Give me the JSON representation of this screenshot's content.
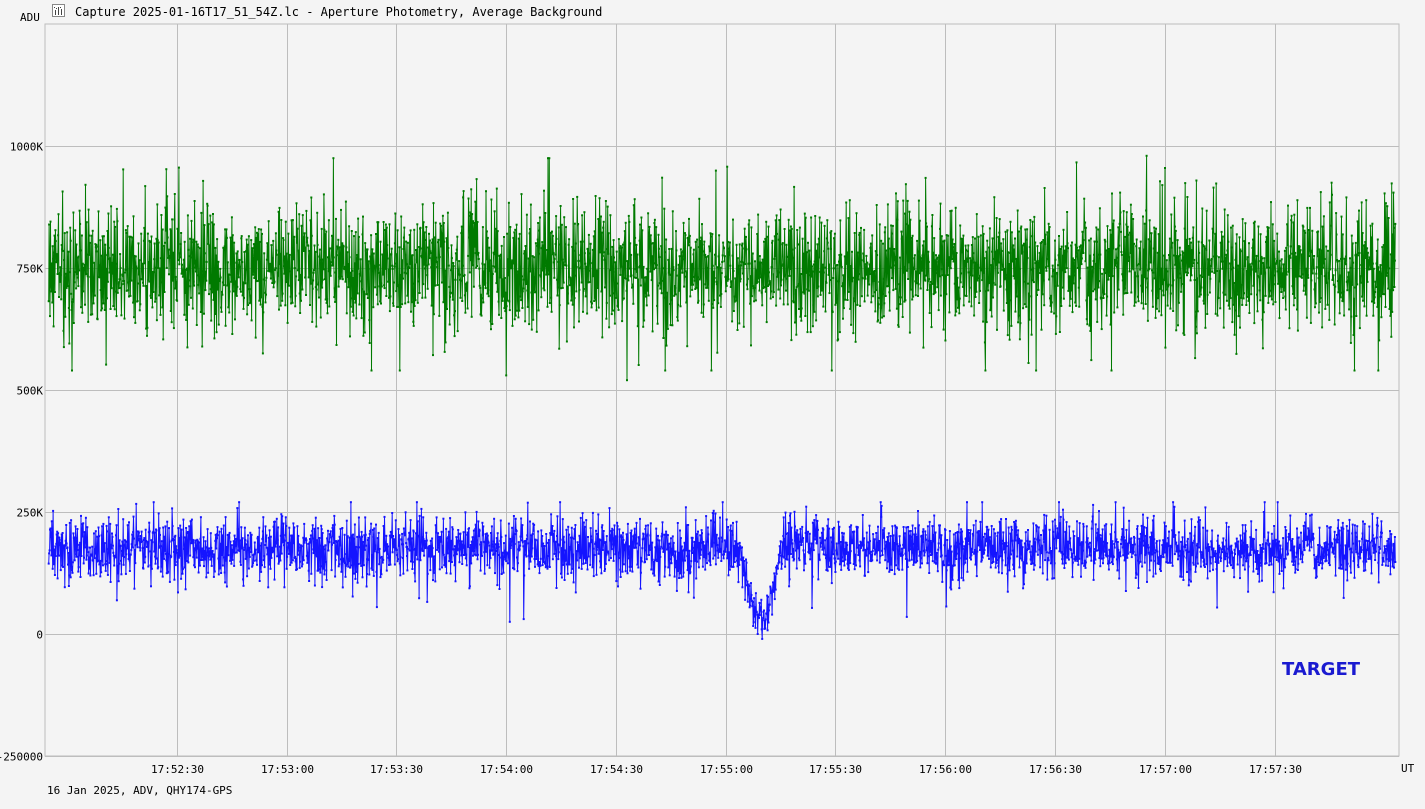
{
  "window": {
    "title": "Capture 2025-01-16T17_51_54Z.lc - Aperture Photometry, Average Background",
    "icon": "lightcurve-icon"
  },
  "footer": "16 Jan 2025, ADV, QHY174-GPS",
  "target_label": "TARGET",
  "colors": {
    "background": "#f4f4f4",
    "grid": "#bdbdbd",
    "series_background": "#007a00",
    "series_target": "#1414ff",
    "target_label": "#1a1ad0"
  },
  "chart_data": {
    "type": "line",
    "title": "",
    "ylabel": "ADU",
    "xlabel": "UT",
    "grid": true,
    "markers": true,
    "xlim": [
      "17:51:54",
      "17:58:04"
    ],
    "ylim": [
      -250000,
      1250000
    ],
    "y_ticks": [
      -250000,
      0,
      250000,
      500000,
      750000,
      1000000
    ],
    "y_tick_labels": [
      "-250000",
      "0",
      "250K",
      "500K",
      "750K",
      "1000K"
    ],
    "x_ticks": [
      "17:52:30",
      "17:53:00",
      "17:53:30",
      "17:54:00",
      "17:54:30",
      "17:55:00",
      "17:55:30",
      "17:56:00",
      "17:56:30",
      "17:57:00",
      "17:57:30"
    ],
    "series": [
      {
        "role": "background",
        "color": "#007a00",
        "summary": {
          "mean": 750000,
          "min": 525000,
          "max": 980000
        },
        "notable_points": [
          {
            "x": "17:54:00",
            "y": 530000
          },
          {
            "x": "17:54:33",
            "y": 520000
          },
          {
            "x": "17:56:55",
            "y": 980000
          },
          {
            "x": "17:57:00",
            "y": 955000
          }
        ]
      },
      {
        "role": "target",
        "color": "#1414ff",
        "summary": {
          "mean": 175000,
          "min": -10000,
          "max": 275000
        },
        "notable_points": [
          {
            "x": "17:54:01",
            "y": 25000
          },
          {
            "x": "17:55:04",
            "y": 180000
          },
          {
            "x": "17:55:05",
            "y": 120000
          },
          {
            "x": "17:55:07",
            "y": 80000
          },
          {
            "x": "17:55:08",
            "y": 55000
          },
          {
            "x": "17:55:09",
            "y": 40000
          },
          {
            "x": "17:55:10",
            "y": -10000
          },
          {
            "x": "17:55:11",
            "y": 30000
          },
          {
            "x": "17:55:12",
            "y": 60000
          },
          {
            "x": "17:55:13",
            "y": 100000
          },
          {
            "x": "17:55:14",
            "y": 140000
          },
          {
            "x": "17:55:15",
            "y": 190000
          }
        ],
        "event": {
          "type": "occultation-dip",
          "start": "17:55:04",
          "end": "17:55:15",
          "min_y": -10000
        }
      }
    ]
  }
}
